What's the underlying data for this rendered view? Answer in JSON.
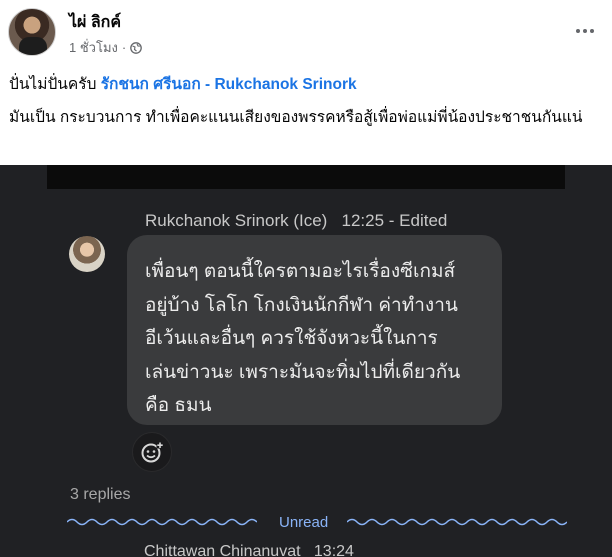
{
  "post": {
    "author": "ไผ่ ลิกค์",
    "time": "1 ชั่วโมง",
    "separator": "·",
    "audience_icon": "globe-icon",
    "more_icon": "more-options-icon",
    "line1_prefix": "ปั่นไม่ปั่นครับ ",
    "mention": "รักชนก ศรีนอก - Rukchanok Srinork",
    "body": "มันเป็น กระบวนการ ทำเพื่อคะแนนเสียงของพรรคหรือสู้เพื่อพ่อแม่พี่น้องประชาชนกันแน่"
  },
  "chat": {
    "sender": "Rukchanok Srinork (Ice)",
    "timestamp": "12:25",
    "edited": "- Edited",
    "message_lines": [
      "เพื่อนๆ ตอนนี้ใครตามอะไรเรื่องซีเกมส์",
      "อยู่บ้าง โลโก โกงเงินนักกีฬา ค่าทำงาน",
      "อีเว้นและอื่นๆ ควรใช้จังหวะนี้ในการ",
      "เล่นข่าวนะ เพราะมันจะทิ่มไปที่เดียวกัน",
      "คือ ธมน"
    ],
    "reaction_icon": "add-emoji-icon",
    "replies": "3 replies",
    "unread_label": "Unread",
    "next_sender": "Chittawan Chinanuvat",
    "next_timestamp": "13:24"
  },
  "colors": {
    "mention": "#1b74e4",
    "chat_bg": "#202124",
    "bubble_bg": "#3a3b3d",
    "unread": "#8ab4f8"
  }
}
